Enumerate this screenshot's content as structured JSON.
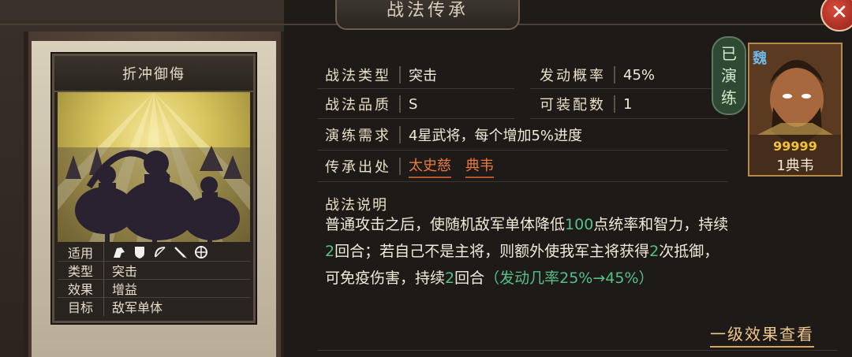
{
  "window": {
    "title": "战法传承",
    "close_label": "✕"
  },
  "card": {
    "name": "折冲御侮",
    "info": {
      "use_label": "适用",
      "use_icons": [
        "cavalry-icon",
        "shield-icon",
        "bow-icon",
        "spear-icon",
        "wheel-icon"
      ],
      "type_label": "类型",
      "type_value": "突击",
      "effect_label": "效果",
      "effect_value": "增益",
      "target_label": "目标",
      "target_value": "敌军单体"
    }
  },
  "details": {
    "type_label": "战法类型",
    "type_value": "突击",
    "prob_label": "发动概率",
    "prob_value": "45%",
    "quality_label": "战法品质",
    "quality_value": "S",
    "equip_label": "可装配数",
    "equip_value": "1",
    "practice_label": "演练需求",
    "practice_value": "4星武将，每个增加5%进度",
    "origin_label": "传承出处",
    "origin_values": [
      "太史慈",
      "典韦"
    ]
  },
  "hero": {
    "faction": "魏",
    "stars": "99999",
    "name": "1典韦",
    "badge_chars": [
      "已",
      "演",
      "练"
    ]
  },
  "description": {
    "title": "战法说明",
    "p1": "普通攻击之后，使随机敌军单体降低",
    "p1_num": "100",
    "p2": "点统率和智力，持续",
    "p3_num": "2",
    "p4": "回合；若自己不是主将，则额外使我军主将获得",
    "p5_num": "2",
    "p6": "次抵御，",
    "p7": "可免疫伤害，持续",
    "p8_num": "2",
    "p9": "回合",
    "p10": "（发动几率25%→45%）"
  },
  "footer": {
    "more_label": "一级效果查看"
  },
  "colors": {
    "accent_orange": "#e87a42",
    "accent_green": "#56c08a",
    "link_gold": "#f0c88d"
  }
}
